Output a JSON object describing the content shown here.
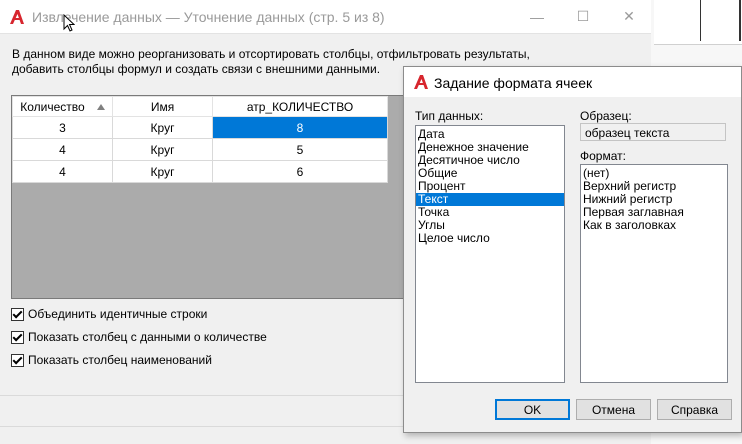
{
  "main_window": {
    "title": "Извлечение данных — Уточнение данных (стр. 5 из 8)",
    "minimize_glyph": "—",
    "maximize_glyph": "☐",
    "close_glyph": "✕",
    "description_line1": "В данном виде можно реорганизовать и отсортировать столбцы, отфильтровать результаты,",
    "description_line2": "добавить столбцы формул и создать связи с внешними данными.",
    "grid": {
      "columns": [
        "Количество",
        "Имя",
        "атр_КОЛИЧЕСТВО"
      ],
      "rows": [
        [
          "3",
          "Круг",
          "8"
        ],
        [
          "4",
          "Круг",
          "5"
        ],
        [
          "4",
          "Круг",
          "6"
        ]
      ]
    },
    "checkboxes": [
      {
        "label": "Объединить идентичные строки",
        "checked": true
      },
      {
        "label": "Показать столбец с данными о количестве",
        "checked": true
      },
      {
        "label": "Показать столбец наименований",
        "checked": true
      }
    ]
  },
  "format_dialog": {
    "title": "Задание формата ячеек",
    "data_type_label": "Тип данных:",
    "data_types": [
      "Дата",
      "Денежное значение",
      "Десятичное число",
      "Общие",
      "Процент",
      "Текст",
      "Точка",
      "Углы",
      "Целое число"
    ],
    "selected_data_type": "Текст",
    "sample_label": "Образец:",
    "sample_value": "образец текста",
    "format_label": "Формат:",
    "formats": [
      "(нет)",
      "Верхний регистр",
      "Нижний регистр",
      "Первая заглавная",
      "Как в заголовках"
    ],
    "ok_label": "OK",
    "cancel_label": "Отмена",
    "help_label": "Справка"
  },
  "colors": {
    "accent": "#0078d7",
    "logo_red": "#d7262e"
  },
  "icons": {
    "app_logo": "autocad-logo-icon",
    "sort": "sort-ascending-icon",
    "checkbox": "checkmark-icon"
  }
}
